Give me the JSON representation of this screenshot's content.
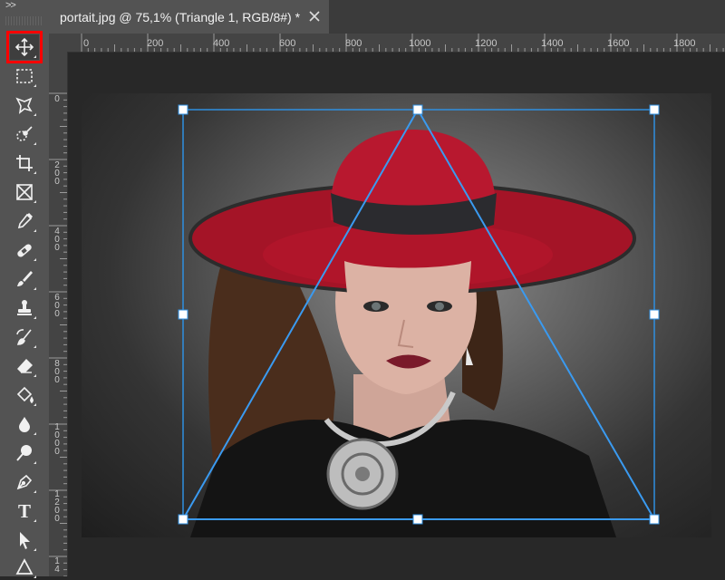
{
  "toolbar": {
    "collapse_label": ">>",
    "tools": [
      {
        "name": "move-tool",
        "icon": "move-icon",
        "selected": true
      },
      {
        "name": "marquee-tool",
        "icon": "rect-marquee-icon"
      },
      {
        "name": "lasso-tool",
        "icon": "polygonal-lasso-icon"
      },
      {
        "name": "quick-select-tool",
        "icon": "quick-selection-icon"
      },
      {
        "name": "crop-tool",
        "icon": "crop-icon"
      },
      {
        "name": "frame-tool",
        "icon": "frame-icon"
      },
      {
        "name": "eyedropper-tool",
        "icon": "eyedropper-icon"
      },
      {
        "name": "healing-tool",
        "icon": "bandage-icon"
      },
      {
        "name": "brush-tool",
        "icon": "brush-icon"
      },
      {
        "name": "stamp-tool",
        "icon": "clone-stamp-icon"
      },
      {
        "name": "history-brush-tool",
        "icon": "history-brush-icon"
      },
      {
        "name": "eraser-tool",
        "icon": "eraser-icon"
      },
      {
        "name": "paint-bucket-tool",
        "icon": "paint-bucket-icon"
      },
      {
        "name": "blur-tool",
        "icon": "drop-icon"
      },
      {
        "name": "dodge-tool",
        "icon": "dodge-icon"
      },
      {
        "name": "pen-tool",
        "icon": "pen-icon"
      },
      {
        "name": "type-tool",
        "icon": "type-icon",
        "letter": "T"
      },
      {
        "name": "path-select-tool",
        "icon": "arrow-icon"
      },
      {
        "name": "shape-tool",
        "icon": "triangle-shape-icon"
      }
    ]
  },
  "document": {
    "tab_title": "portait.jpg @ 75,1% (Triangle 1, RGB/8#) *",
    "close_icon": "close-icon"
  },
  "rulers": {
    "top": [
      "0",
      "200",
      "400",
      "600",
      "800",
      "1000",
      "1200",
      "1400",
      "1600",
      "1800"
    ],
    "left": [
      "0",
      "200",
      "400",
      "600",
      "800",
      "1000",
      "1200",
      "14"
    ]
  },
  "colors": {
    "selection_highlight": "#ff0000",
    "path_stroke": "#2f8fe0",
    "handle_fill": "#ffffff",
    "hat_red": "#b0152a"
  }
}
